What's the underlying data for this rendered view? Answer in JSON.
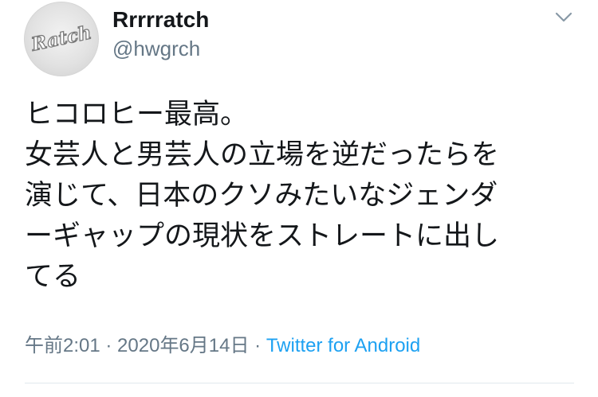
{
  "author": {
    "avatar_text": "Ratch",
    "display_name": "Rrrrratch",
    "handle": "@hwgrch"
  },
  "tweet": {
    "text": "ヒコロヒー最高。\n女芸人と男芸人の立場を逆だったらを\n演じて、日本のクソみたいなジェンダ\nーギャップの現状をストレートに出し\nてる",
    "time": "午前2:01",
    "separator_1": " · ",
    "date": "2020年6月14日",
    "separator_2": " · ",
    "source": "Twitter for Android"
  },
  "icons": {
    "menu": "chevron-down-icon"
  },
  "colors": {
    "text": "#14171a",
    "secondary": "#657786",
    "link": "#1da1f2",
    "divider": "#e1e8ed"
  }
}
